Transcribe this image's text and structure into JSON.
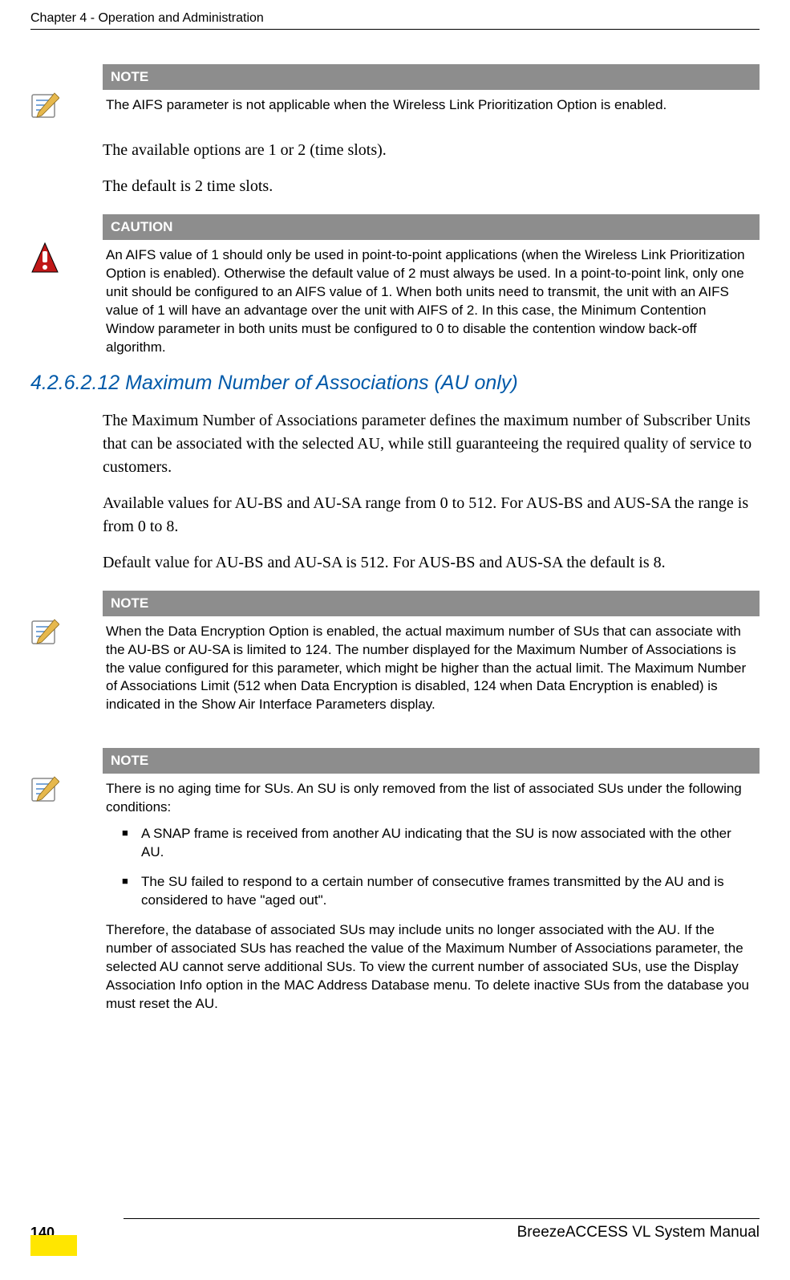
{
  "header": {
    "chapter": "Chapter 4 - Operation and Administration"
  },
  "note1": {
    "title": "NOTE",
    "text": "The AIFS parameter is not applicable when the Wireless Link Prioritization Option is enabled."
  },
  "body1": {
    "p1": "The available options are 1 or 2 (time slots).",
    "p2": "The default is 2 time slots."
  },
  "caution1": {
    "title": "CAUTION",
    "text": "An AIFS value of 1 should only be used in point-to-point applications (when the Wireless Link Prioritization Option is enabled). Otherwise the default value of 2 must always be used. In a point-to-point link, only one unit should be configured to an AIFS value of 1. When both units need to transmit, the unit with an AIFS value of 1 will have an advantage over the unit with AIFS of 2. In this case, the Minimum Contention Window parameter in both units must be configured to 0 to disable the contention window back-off algorithm."
  },
  "section": {
    "number": "4.2.6.2.12",
    "title": "Maximum Number of Associations (AU only)"
  },
  "body2": {
    "p1": "The Maximum Number of Associations parameter defines the maximum number of Subscriber Units that can be associated with the selected AU, while still guaranteeing the required quality of service to customers.",
    "p2": "Available values for AU-BS and AU-SA range from 0 to 512. For AUS-BS and AUS-SA the range is from 0 to 8.",
    "p3": "Default value for AU-BS and AU-SA is 512. For AUS-BS and AUS-SA the default is 8."
  },
  "note2": {
    "title": "NOTE",
    "text": "When the Data Encryption Option is enabled, the actual maximum number of SUs that can associate with the AU-BS or AU-SA is limited to 124. The number displayed for the Maximum Number of Associations is the value configured for this parameter, which might be higher than the actual limit. The Maximum Number of Associations Limit (512 when Data Encryption is disabled, 124 when Data Encryption is enabled) is indicated in the Show Air Interface Parameters display."
  },
  "note3": {
    "title": "NOTE",
    "intro": "There is no aging time for SUs. An SU is only removed from the list of associated SUs under the following conditions:",
    "bullets": [
      "A SNAP frame is received from another AU indicating that the SU is now associated with the other AU.",
      "The SU failed to respond to a certain number of consecutive frames transmitted by the AU and is considered to have \"aged out\"."
    ],
    "outro": "Therefore, the database of associated SUs may include units no longer associated with the AU. If the number of associated SUs has reached the value of the Maximum Number of Associations parameter, the selected AU cannot serve additional SUs. To view the current number of associated SUs, use the Display Association Info option in the MAC Address Database menu. To delete inactive SUs from the database you must reset the AU."
  },
  "footer": {
    "manual": "BreezeACCESS VL System Manual",
    "page": "140"
  }
}
